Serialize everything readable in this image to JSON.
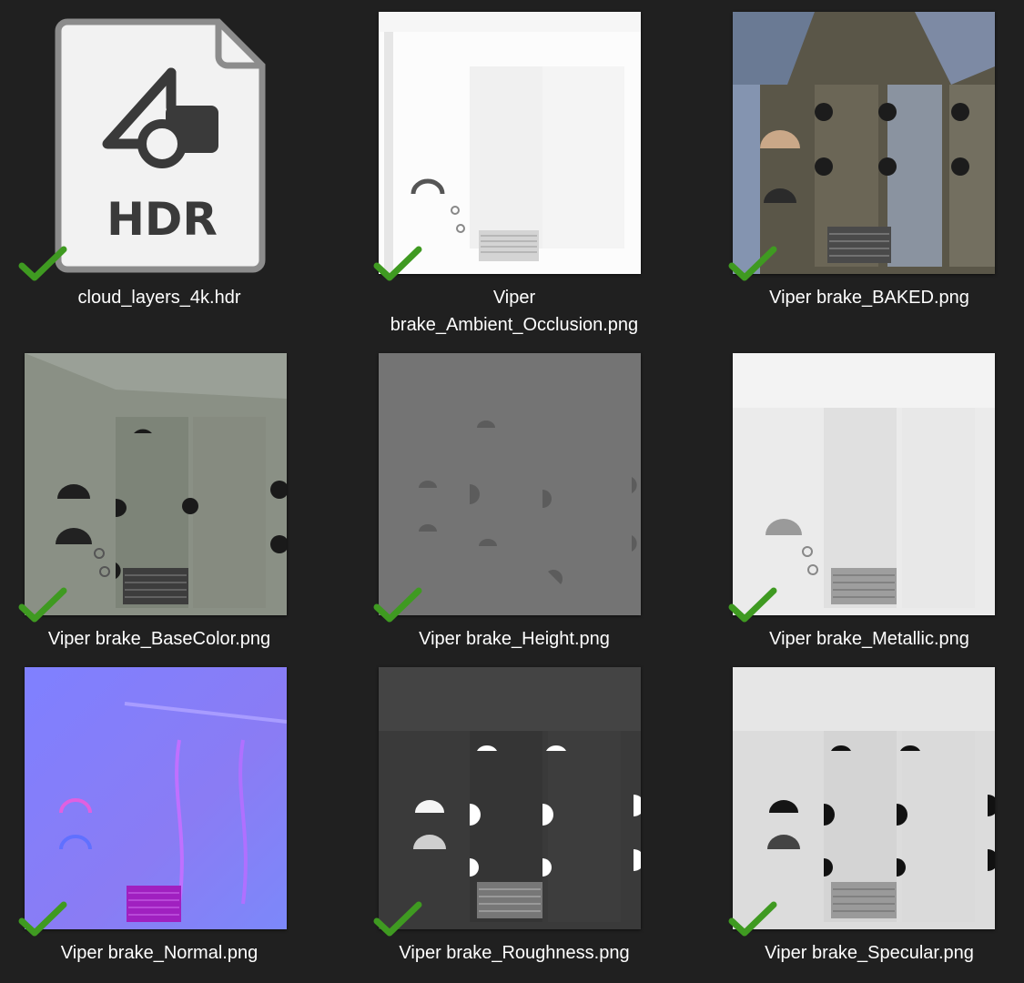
{
  "window": {
    "background": "#202020"
  },
  "accent": {
    "check_color": "#3f9a21"
  },
  "files": [
    {
      "name_lines": [
        "cloud_layers_4k.hdr"
      ],
      "kind": "file-type-icon",
      "icon_text": "HDR",
      "status": "synced",
      "icon": "checkmark-icon"
    },
    {
      "name_lines": [
        "Viper",
        "brake_Ambient_Occlusion.png"
      ],
      "kind": "image-thumbnail",
      "status": "synced",
      "icon": "checkmark-icon"
    },
    {
      "name_lines": [
        "Viper brake_BAKED.png"
      ],
      "kind": "image-thumbnail",
      "status": "synced",
      "icon": "checkmark-icon"
    },
    {
      "name_lines": [
        "Viper brake_BaseColor.png"
      ],
      "kind": "image-thumbnail",
      "status": "synced",
      "icon": "checkmark-icon"
    },
    {
      "name_lines": [
        "Viper brake_Height.png"
      ],
      "kind": "image-thumbnail",
      "status": "synced",
      "icon": "checkmark-icon"
    },
    {
      "name_lines": [
        "Viper brake_Metallic.png"
      ],
      "kind": "image-thumbnail",
      "status": "synced",
      "icon": "checkmark-icon"
    },
    {
      "name_lines": [
        "Viper brake_Normal.png"
      ],
      "kind": "image-thumbnail",
      "status": "synced",
      "icon": "checkmark-icon"
    },
    {
      "name_lines": [
        "Viper brake_Roughness.png"
      ],
      "kind": "image-thumbnail",
      "status": "synced",
      "icon": "checkmark-icon"
    },
    {
      "name_lines": [
        "Viper brake_Specular.png"
      ],
      "kind": "image-thumbnail",
      "status": "synced",
      "icon": "checkmark-icon"
    }
  ]
}
